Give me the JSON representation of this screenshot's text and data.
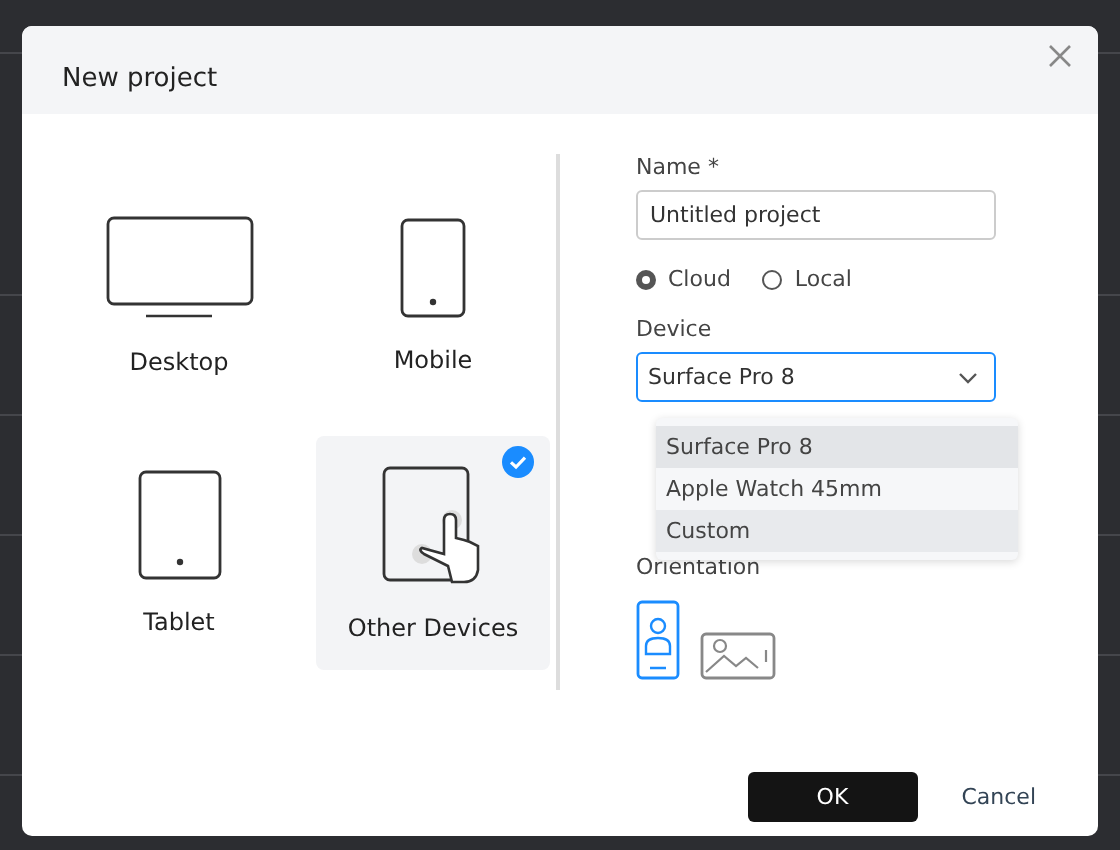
{
  "dialog": {
    "title": "New project",
    "devices": [
      {
        "kind": "desktop",
        "label": "Desktop",
        "selected": false
      },
      {
        "kind": "mobile",
        "label": "Mobile",
        "selected": false
      },
      {
        "kind": "tablet",
        "label": "Tablet",
        "selected": false
      },
      {
        "kind": "other",
        "label": "Other Devices",
        "selected": true
      }
    ],
    "name_label": "Name *",
    "name_value": "Untitled project",
    "storage": [
      {
        "label": "Cloud",
        "selected": true
      },
      {
        "label": "Local",
        "selected": false
      }
    ],
    "device_label": "Device",
    "device_value": "Surface Pro 8",
    "device_options": [
      {
        "label": "Surface Pro 8",
        "selected": true,
        "hovered": false
      },
      {
        "label": "Apple Watch 45mm",
        "selected": false,
        "hovered": false
      },
      {
        "label": "Custom",
        "selected": false,
        "hovered": true
      }
    ],
    "orientation_label": "Orientation",
    "orientations": [
      {
        "kind": "portrait",
        "selected": true
      },
      {
        "kind": "landscape",
        "selected": false
      }
    ],
    "ok": "OK",
    "cancel": "Cancel"
  }
}
